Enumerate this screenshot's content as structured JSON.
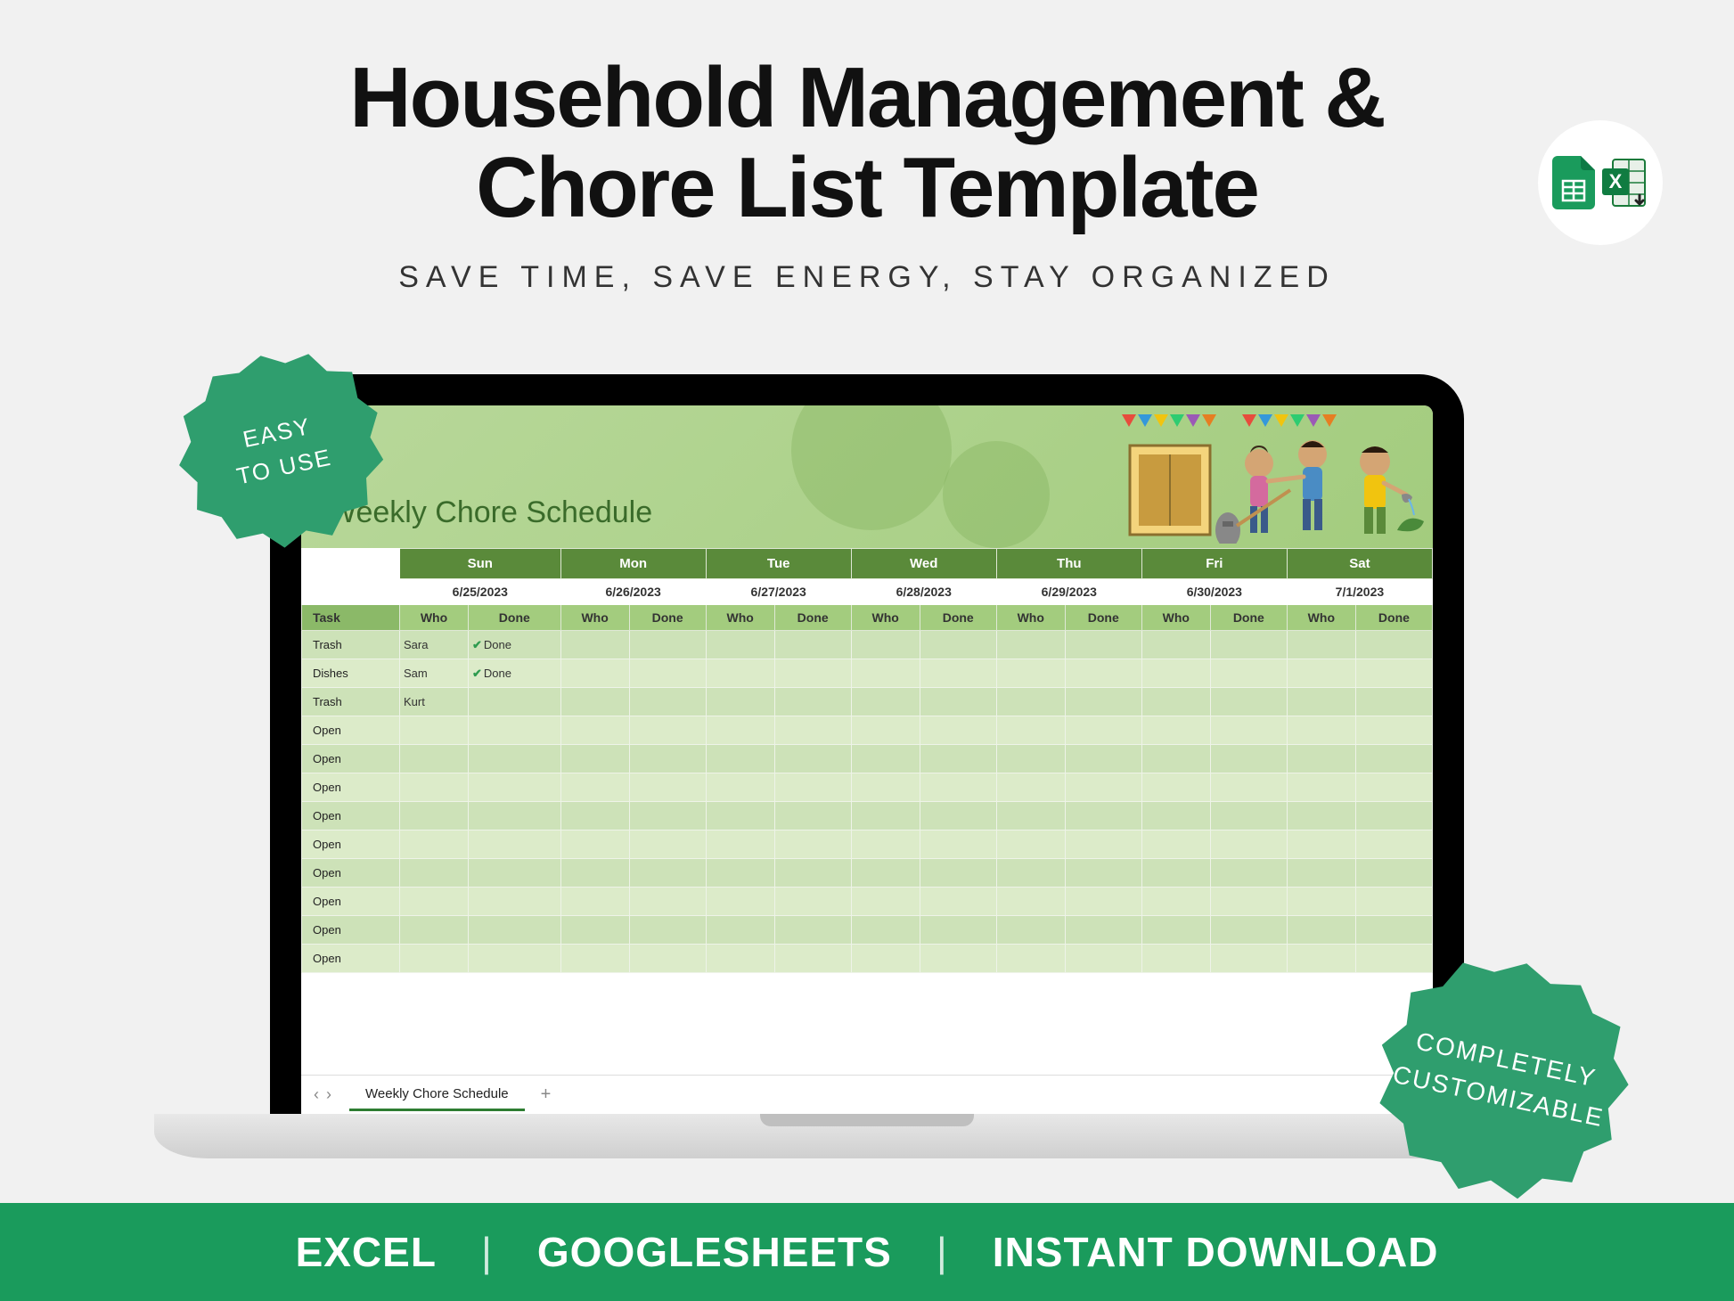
{
  "title_line1": "Household Management &",
  "title_line2": "Chore List Template",
  "subtitle": "SAVE TIME, SAVE ENERGY, STAY ORGANIZED",
  "sheet": {
    "title": "Weekly Chore Schedule",
    "tab_name": "Weekly Chore Schedule",
    "days": [
      {
        "name": "Sun",
        "date": "6/25/2023"
      },
      {
        "name": "Mon",
        "date": "6/26/2023"
      },
      {
        "name": "Tue",
        "date": "6/27/2023"
      },
      {
        "name": "Wed",
        "date": "6/28/2023"
      },
      {
        "name": "Thu",
        "date": "6/29/2023"
      },
      {
        "name": "Fri",
        "date": "6/30/2023"
      },
      {
        "name": "Sat",
        "date": "7/1/2023"
      }
    ],
    "task_header": "Task",
    "who_header": "Who",
    "done_header": "Done",
    "done_label": "Done",
    "rows": [
      {
        "task": "Trash",
        "cells": [
          {
            "who": "Sara",
            "done": true
          },
          {},
          {},
          {},
          {},
          {},
          {}
        ]
      },
      {
        "task": "Dishes",
        "cells": [
          {
            "who": "Sam",
            "done": true
          },
          {},
          {},
          {},
          {},
          {},
          {}
        ]
      },
      {
        "task": "Trash",
        "cells": [
          {
            "who": "Kurt",
            "done": false
          },
          {},
          {},
          {},
          {},
          {},
          {}
        ]
      },
      {
        "task": "Open",
        "cells": [
          {},
          {},
          {},
          {},
          {},
          {},
          {}
        ]
      },
      {
        "task": "Open",
        "cells": [
          {},
          {},
          {},
          {},
          {},
          {},
          {}
        ]
      },
      {
        "task": "Open",
        "cells": [
          {},
          {},
          {},
          {},
          {},
          {},
          {}
        ]
      },
      {
        "task": "Open",
        "cells": [
          {},
          {},
          {},
          {},
          {},
          {},
          {}
        ]
      },
      {
        "task": "Open",
        "cells": [
          {},
          {},
          {},
          {},
          {},
          {},
          {}
        ]
      },
      {
        "task": "Open",
        "cells": [
          {},
          {},
          {},
          {},
          {},
          {},
          {}
        ]
      },
      {
        "task": "Open",
        "cells": [
          {},
          {},
          {},
          {},
          {},
          {},
          {}
        ]
      },
      {
        "task": "Open",
        "cells": [
          {},
          {},
          {},
          {},
          {},
          {},
          {}
        ]
      },
      {
        "task": "Open",
        "cells": [
          {},
          {},
          {},
          {},
          {},
          {},
          {}
        ]
      }
    ]
  },
  "badges": {
    "easy": "EASY\nTO USE",
    "custom": "COMPLETELY\nCUSTOMIZABLE"
  },
  "footer": {
    "item1": "EXCEL",
    "item2": "GOOGLESHEETS",
    "item3": "INSTANT DOWNLOAD"
  }
}
